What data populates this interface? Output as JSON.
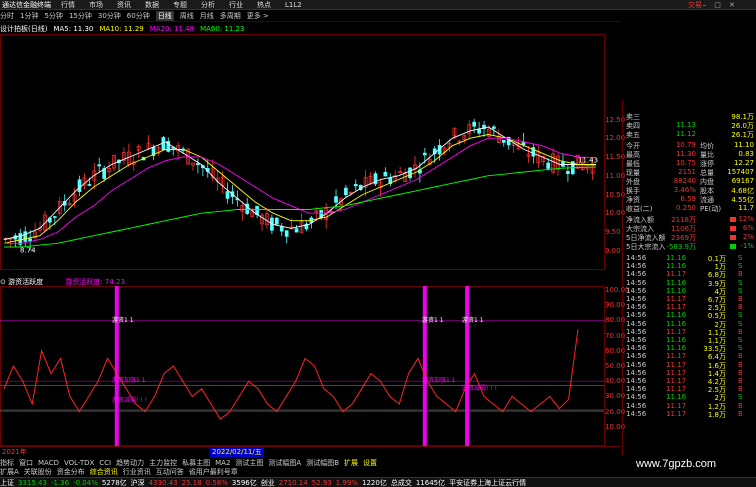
{
  "menubar": {
    "brand": "通达信金融终端",
    "items": [
      "行情",
      "市场",
      "资讯",
      "数据",
      "专题",
      "分析",
      "行业",
      "热点",
      "L1L2"
    ],
    "right": "交易"
  },
  "periods": [
    "分时",
    "1分钟",
    "5分钟",
    "15分钟",
    "30分钟",
    "60分钟",
    "日线",
    "周线",
    "月线",
    "多周期",
    "更多 >"
  ],
  "ma_legend": {
    "title": "设计拍板(日线)",
    "items": [
      {
        "label": "MA5: 11.30",
        "color": "#ffffff"
      },
      {
        "label": "MA10: 11.29",
        "color": "#ffff00"
      },
      {
        "label": "MA20: 11.48",
        "color": "#ff00ff"
      },
      {
        "label": "MA60: 11.23",
        "color": "#00ff00"
      }
    ]
  },
  "price_axis": [
    "12.50",
    "12.00",
    "11.50",
    "11.00",
    "10.50",
    "10.00",
    "9.50",
    "9.00"
  ],
  "kline_annotations": {
    "low": "8.74",
    "high": "",
    "last": "11.43"
  },
  "indicator": {
    "name": "游资活跃度",
    "legend": "游资活跃度: 74.23",
    "axis": [
      "100.00",
      "90.00",
      "80.00",
      "70.00",
      "60.00",
      "50.00",
      "40.00",
      "30.00",
      "20.00",
      "10.00"
    ],
    "labels": {
      "active": "游资1 1",
      "weak": "游资减弱! ! !",
      "strong": "游资加强1 1"
    }
  },
  "xaxis": {
    "start": "2021年",
    "cursor": "2022/02/11/五"
  },
  "quote_panel": {
    "asks": [
      {
        "label": "卖三",
        "price": "",
        "vol": "98.1万"
      },
      {
        "label": "卖四",
        "price": "11.13",
        "vol": "26.0万"
      },
      {
        "label": "卖五",
        "price": "11.12",
        "vol": "26.1万"
      }
    ],
    "stats": [
      {
        "l": "今开",
        "v": "10.79",
        "l2": "均价",
        "v2": "11.10"
      },
      {
        "l": "最高",
        "v": "11.30",
        "l2": "量比",
        "v2": "0.83"
      },
      {
        "l": "最低",
        "v": "10.75",
        "l2": "涨停",
        "v2": "12.27"
      },
      {
        "l": "现量",
        "v": "2151",
        "l2": "总量",
        "v2": "157407"
      },
      {
        "l": "外盘",
        "v": "88240",
        "l2": "内盘",
        "v2": "69167"
      },
      {
        "l": "换手",
        "v": "3.46%",
        "l2": "股本",
        "v2": "4.68亿"
      },
      {
        "l": "净资",
        "v": "6.59",
        "l2": "流通",
        "v2": "4.55亿"
      },
      {
        "l": "收益(二)",
        "v": "0.250",
        "l2": "PE(动)",
        "v2": "11.7"
      }
    ],
    "flows": [
      {
        "l": "净流入额",
        "v": "2118万",
        "p": "12%"
      },
      {
        "l": "大宗流入",
        "v": "1106万",
        "p": "6%"
      },
      {
        "l": "5日净流入额",
        "v": "2369万",
        "p": "2%"
      },
      {
        "l": "5日大宗流入",
        "v": "-583.9万",
        "p": "-1%"
      }
    ]
  },
  "ticks": [
    {
      "t": "14:56",
      "p": "11.16",
      "q": "0.1万",
      "bs": "S"
    },
    {
      "t": "14:56",
      "p": "11.16",
      "q": "1万",
      "bs": "S"
    },
    {
      "t": "14:56",
      "p": "11.17",
      "q": "6.8万",
      "bs": "B"
    },
    {
      "t": "14:56",
      "p": "11.16",
      "q": "3.9万",
      "bs": "S"
    },
    {
      "t": "14:56",
      "p": "11.16",
      "q": "4万",
      "bs": "S"
    },
    {
      "t": "14:56",
      "p": "11.17",
      "q": "6.7万",
      "bs": "B"
    },
    {
      "t": "14:56",
      "p": "11.17",
      "q": "2.5万",
      "bs": "B"
    },
    {
      "t": "14:56",
      "p": "11.16",
      "q": "0.5万",
      "bs": "S"
    },
    {
      "t": "14:56",
      "p": "11.16",
      "q": "2万",
      "bs": "S"
    },
    {
      "t": "14:56",
      "p": "11.17",
      "q": "1.1万",
      "bs": "B"
    },
    {
      "t": "14:56",
      "p": "11.16",
      "q": "1.1万",
      "bs": "S"
    },
    {
      "t": "14:56",
      "p": "11.16",
      "q": "33.5万",
      "bs": "S"
    },
    {
      "t": "14:56",
      "p": "11.17",
      "q": "6.4万",
      "bs": "B"
    },
    {
      "t": "14:56",
      "p": "11.17",
      "q": "1.6万",
      "bs": "B"
    },
    {
      "t": "14:56",
      "p": "11.17",
      "q": "1.4万",
      "bs": "B"
    },
    {
      "t": "14:56",
      "p": "11.17",
      "q": "4.2万",
      "bs": "B"
    },
    {
      "t": "14:56",
      "p": "11.17",
      "q": "2.5万",
      "bs": "B"
    },
    {
      "t": "14:56",
      "p": "11.16",
      "q": "2万",
      "bs": "S"
    },
    {
      "t": "14:56",
      "p": "11.17",
      "q": "1.2万",
      "bs": "B"
    },
    {
      "t": "14:56",
      "p": "11.17",
      "q": "1.8万",
      "bs": "B"
    }
  ],
  "tabs": [
    "指标",
    "窗口",
    "MACD",
    "VOL-TDX",
    "CCI",
    "趋势动力",
    "主力监控",
    "私募主图",
    "MA2",
    "测试主图",
    "测试幅图A",
    "测试幅图B",
    "扩展",
    "设置"
  ],
  "tabs2": [
    "扩展A",
    "关联股份",
    "资金分布",
    "综合资讯",
    "行业资讯",
    "互动问答",
    "省用户最利号章"
  ],
  "statusbar": {
    "sh_label": "上证",
    "sh": "3315.43",
    "sh_chg": "-1.36",
    "sh_pct": "-0.04%",
    "sh_amt": "5278亿",
    "hs_label": "沪深",
    "hs": "4330.43",
    "hs_chg": "25.18",
    "hs_pct": "0.58%",
    "hs_amt": "3596亿",
    "cy_label": "创业",
    "cy": "2710.14",
    "cy_chg": "52.93",
    "cy_pct": "1.99%",
    "cy_amt": "1220亿",
    "total": "总成交",
    "total_v": "11645亿",
    "note": "平安证券上海上证云行情"
  },
  "watermark": "www.7gpzb.com",
  "chart_data": {
    "type": "line",
    "title": "设计拍板(日线)",
    "ylim": [
      8.7,
      12.7
    ],
    "series": [
      {
        "name": "MA5",
        "values": [
          9.3,
          9.4,
          9.6,
          10.1,
          10.6,
          11.0,
          11.3,
          11.5,
          11.7,
          11.9,
          11.6,
          11.3,
          10.8,
          10.4,
          10.0,
          9.7,
          9.6,
          9.7,
          10.0,
          10.4,
          10.7,
          10.9,
          11.0,
          11.2,
          11.6,
          12.0,
          12.2,
          12.3,
          12.0,
          11.7,
          11.5,
          11.3,
          11.3,
          11.3
        ]
      },
      {
        "name": "MA10",
        "values": [
          9.2,
          9.3,
          9.4,
          9.8,
          10.3,
          10.7,
          11.0,
          11.3,
          11.5,
          11.7,
          11.7,
          11.5,
          11.1,
          10.7,
          10.3,
          10.0,
          9.8,
          9.8,
          9.9,
          10.2,
          10.5,
          10.7,
          10.9,
          11.1,
          11.4,
          11.8,
          12.0,
          12.1,
          12.0,
          11.8,
          11.6,
          11.4,
          11.3,
          11.29
        ]
      },
      {
        "name": "MA20",
        "values": [
          9.2,
          9.2,
          9.3,
          9.5,
          9.9,
          10.2,
          10.6,
          10.9,
          11.2,
          11.4,
          11.5,
          11.5,
          11.3,
          11.0,
          10.7,
          10.4,
          10.2,
          10.0,
          10.0,
          10.1,
          10.3,
          10.5,
          10.7,
          10.9,
          11.2,
          11.5,
          11.8,
          12.0,
          12.0,
          11.9,
          11.8,
          11.6,
          11.5,
          11.48
        ]
      },
      {
        "name": "MA60",
        "values": [
          9.1,
          9.1,
          9.15,
          9.2,
          9.3,
          9.4,
          9.5,
          9.6,
          9.7,
          9.8,
          9.9,
          10.0,
          10.05,
          10.1,
          10.1,
          10.1,
          10.1,
          10.1,
          10.15,
          10.2,
          10.3,
          10.4,
          10.5,
          10.6,
          10.7,
          10.8,
          10.9,
          11.0,
          11.05,
          11.1,
          11.15,
          11.2,
          11.22,
          11.23
        ]
      }
    ],
    "indicator_series": {
      "name": "游资活跃度",
      "ylim": [
        0,
        100
      ],
      "values": [
        35,
        50,
        40,
        25,
        60,
        45,
        55,
        30,
        20,
        30,
        40,
        55,
        45,
        35,
        25,
        20,
        30,
        45,
        50,
        40,
        30,
        35,
        25,
        15,
        20,
        30,
        40,
        35,
        25,
        20,
        30,
        40,
        55,
        50,
        35,
        30,
        20,
        25,
        35,
        45,
        40,
        30,
        25,
        45,
        55,
        40,
        30,
        25,
        20,
        35,
        45,
        30,
        25,
        20,
        30,
        25,
        20,
        25,
        30,
        22,
        28,
        74.23
      ]
    },
    "signal_bars_x": [
      0.19,
      0.7,
      0.77
    ]
  }
}
